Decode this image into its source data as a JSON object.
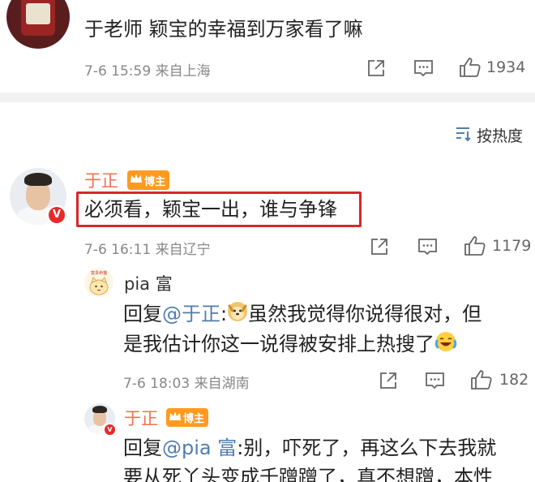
{
  "top_post": {
    "text": "于老师 颖宝的幸福到万家看了嘛",
    "meta": "7-6 15:59 来自上海",
    "like_count": "1934"
  },
  "sort": {
    "label": "按热度"
  },
  "comment1": {
    "author": "于正",
    "badge": "博主",
    "text": "必须看，颖宝一出，谁与争锋",
    "meta": "7-6 16:11 来自辽宁",
    "like_count": "1179"
  },
  "reply1": {
    "author": "pia 富",
    "avatar_caption": "富贵命猫",
    "prefix": "回复",
    "mention": "@于正",
    "line1_rest": ":",
    "line1_tail": "虽然我觉得你说得很对，但",
    "line2": "是我估计你这一说得被安排上热搜了",
    "meta": "7-6 18:03 来自湖南",
    "like_count": "182"
  },
  "reply2": {
    "author": "于正",
    "badge": "博主",
    "prefix": "回复",
    "mention": "@pia 富",
    "line1_rest": ":别，吓死了，再这么下去我就",
    "line2": "要从死丫头变成千蹭蹭了，真不想蹭，本性"
  },
  "icons": {
    "share": "share-icon",
    "comment": "comment-icon",
    "like": "thumbs-up-icon",
    "sort": "sort-icon"
  },
  "colors": {
    "name_orange": "#eb7350",
    "mention_blue": "#507daf",
    "highlight_red": "#d8262a",
    "badge_orange": "#ff9a1f"
  }
}
